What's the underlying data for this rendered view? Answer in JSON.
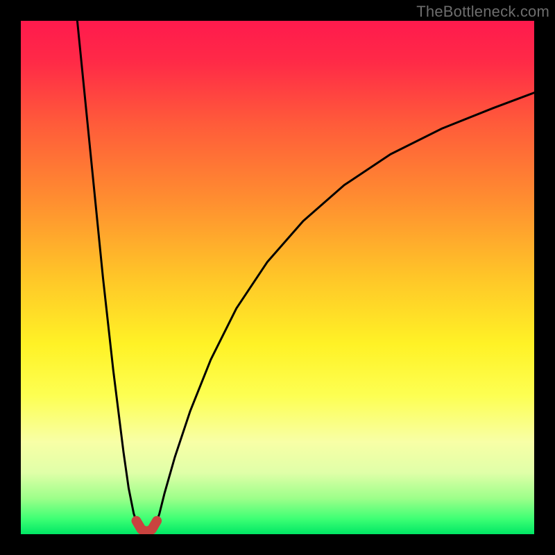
{
  "watermark": "TheBottleneck.com",
  "gradient": {
    "stops": [
      {
        "offset": 0.0,
        "color": "#ff1a4d"
      },
      {
        "offset": 0.08,
        "color": "#ff2a47"
      },
      {
        "offset": 0.2,
        "color": "#ff5b3a"
      },
      {
        "offset": 0.35,
        "color": "#ff8e30"
      },
      {
        "offset": 0.5,
        "color": "#ffc628"
      },
      {
        "offset": 0.63,
        "color": "#fff226"
      },
      {
        "offset": 0.73,
        "color": "#fdff52"
      },
      {
        "offset": 0.82,
        "color": "#f8ffa6"
      },
      {
        "offset": 0.88,
        "color": "#e0ffa8"
      },
      {
        "offset": 0.93,
        "color": "#9dff8a"
      },
      {
        "offset": 0.97,
        "color": "#3eff74"
      },
      {
        "offset": 1.0,
        "color": "#00e765"
      }
    ]
  },
  "chart_data": {
    "type": "line",
    "title": "",
    "xlabel": "",
    "ylabel": "",
    "xlim": [
      0,
      100
    ],
    "ylim": [
      0,
      100
    ],
    "series": [
      {
        "name": "left-branch",
        "x": [
          11,
          12,
          13,
          14,
          15,
          16,
          17,
          18,
          19,
          20,
          21,
          22,
          23
        ],
        "y": [
          100,
          90,
          80,
          70,
          60,
          50,
          41,
          32,
          24,
          16,
          9,
          4,
          1
        ]
      },
      {
        "name": "right-branch",
        "x": [
          26,
          27,
          28,
          30,
          33,
          37,
          42,
          48,
          55,
          63,
          72,
          82,
          92,
          100
        ],
        "y": [
          1,
          4,
          8,
          15,
          24,
          34,
          44,
          53,
          61,
          68,
          74,
          79,
          83,
          86
        ]
      },
      {
        "name": "valley-marker",
        "style": "thick-red",
        "x": [
          22.5,
          23.5,
          24.5,
          25.5,
          26.5
        ],
        "y": [
          2.6,
          0.9,
          0.5,
          0.9,
          2.6
        ]
      }
    ]
  }
}
